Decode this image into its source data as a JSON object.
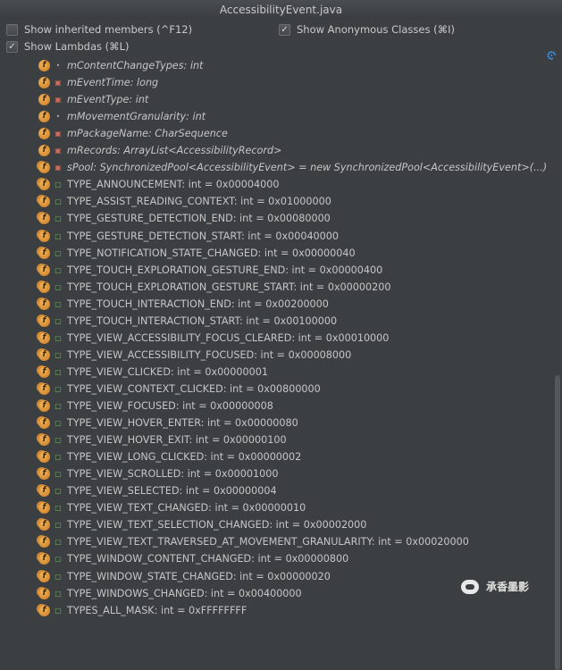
{
  "window": {
    "title": "AccessibilityEvent.java"
  },
  "options": {
    "show_inherited": {
      "label": "Show inherited members (^F12)",
      "checked": false
    },
    "show_anonymous": {
      "label": "Show Anonymous Classes (⌘I)",
      "checked": true
    },
    "show_lambdas": {
      "label": "Show Lambdas (⌘L)",
      "checked": true
    }
  },
  "icons": {
    "settings": "gear-icon"
  },
  "members": [
    {
      "label": "mContentChangeTypes: int",
      "visibility": "package",
      "static": false,
      "italic": true
    },
    {
      "label": "mEventTime: long",
      "visibility": "private",
      "static": false,
      "italic": true
    },
    {
      "label": "mEventType: int",
      "visibility": "private",
      "static": false,
      "italic": true
    },
    {
      "label": "mMovementGranularity: int",
      "visibility": "package",
      "static": false,
      "italic": true
    },
    {
      "label": "mPackageName: CharSequence",
      "visibility": "private",
      "static": false,
      "italic": true
    },
    {
      "label": "mRecords: ArrayList<AccessibilityRecord>",
      "visibility": "private",
      "static": false,
      "italic": true
    },
    {
      "label": "sPool: SynchronizedPool<AccessibilityEvent> = new SynchronizedPool<AccessibilityEvent>(...)",
      "visibility": "private",
      "static": true,
      "italic": true
    },
    {
      "label": "TYPE_ANNOUNCEMENT: int = 0x00004000",
      "visibility": "public",
      "static": true,
      "italic": false
    },
    {
      "label": "TYPE_ASSIST_READING_CONTEXT: int = 0x01000000",
      "visibility": "public",
      "static": true,
      "italic": false
    },
    {
      "label": "TYPE_GESTURE_DETECTION_END: int = 0x00080000",
      "visibility": "public",
      "static": true,
      "italic": false
    },
    {
      "label": "TYPE_GESTURE_DETECTION_START: int = 0x00040000",
      "visibility": "public",
      "static": true,
      "italic": false
    },
    {
      "label": "TYPE_NOTIFICATION_STATE_CHANGED: int = 0x00000040",
      "visibility": "public",
      "static": true,
      "italic": false
    },
    {
      "label": "TYPE_TOUCH_EXPLORATION_GESTURE_END: int = 0x00000400",
      "visibility": "public",
      "static": true,
      "italic": false
    },
    {
      "label": "TYPE_TOUCH_EXPLORATION_GESTURE_START: int = 0x00000200",
      "visibility": "public",
      "static": true,
      "italic": false
    },
    {
      "label": "TYPE_TOUCH_INTERACTION_END: int = 0x00200000",
      "visibility": "public",
      "static": true,
      "italic": false
    },
    {
      "label": "TYPE_TOUCH_INTERACTION_START: int = 0x00100000",
      "visibility": "public",
      "static": true,
      "italic": false
    },
    {
      "label": "TYPE_VIEW_ACCESSIBILITY_FOCUS_CLEARED: int = 0x00010000",
      "visibility": "public",
      "static": true,
      "italic": false
    },
    {
      "label": "TYPE_VIEW_ACCESSIBILITY_FOCUSED: int = 0x00008000",
      "visibility": "public",
      "static": true,
      "italic": false
    },
    {
      "label": "TYPE_VIEW_CLICKED: int = 0x00000001",
      "visibility": "public",
      "static": true,
      "italic": false
    },
    {
      "label": "TYPE_VIEW_CONTEXT_CLICKED: int = 0x00800000",
      "visibility": "public",
      "static": true,
      "italic": false
    },
    {
      "label": "TYPE_VIEW_FOCUSED: int = 0x00000008",
      "visibility": "public",
      "static": true,
      "italic": false
    },
    {
      "label": "TYPE_VIEW_HOVER_ENTER: int = 0x00000080",
      "visibility": "public",
      "static": true,
      "italic": false
    },
    {
      "label": "TYPE_VIEW_HOVER_EXIT: int = 0x00000100",
      "visibility": "public",
      "static": true,
      "italic": false
    },
    {
      "label": "TYPE_VIEW_LONG_CLICKED: int = 0x00000002",
      "visibility": "public",
      "static": true,
      "italic": false
    },
    {
      "label": "TYPE_VIEW_SCROLLED: int = 0x00001000",
      "visibility": "public",
      "static": true,
      "italic": false
    },
    {
      "label": "TYPE_VIEW_SELECTED: int = 0x00000004",
      "visibility": "public",
      "static": true,
      "italic": false
    },
    {
      "label": "TYPE_VIEW_TEXT_CHANGED: int = 0x00000010",
      "visibility": "public",
      "static": true,
      "italic": false
    },
    {
      "label": "TYPE_VIEW_TEXT_SELECTION_CHANGED: int = 0x00002000",
      "visibility": "public",
      "static": true,
      "italic": false
    },
    {
      "label": "TYPE_VIEW_TEXT_TRAVERSED_AT_MOVEMENT_GRANULARITY: int = 0x00020000",
      "visibility": "public",
      "static": true,
      "italic": false
    },
    {
      "label": "TYPE_WINDOW_CONTENT_CHANGED: int = 0x00000800",
      "visibility": "public",
      "static": true,
      "italic": false
    },
    {
      "label": "TYPE_WINDOW_STATE_CHANGED: int = 0x00000020",
      "visibility": "public",
      "static": true,
      "italic": false
    },
    {
      "label": "TYPE_WINDOWS_CHANGED: int = 0x00400000",
      "visibility": "public",
      "static": true,
      "italic": false
    },
    {
      "label": "TYPES_ALL_MASK: int = 0xFFFFFFFF",
      "visibility": "public",
      "static": true,
      "italic": false
    }
  ],
  "watermark": {
    "text": "承香墨影"
  }
}
